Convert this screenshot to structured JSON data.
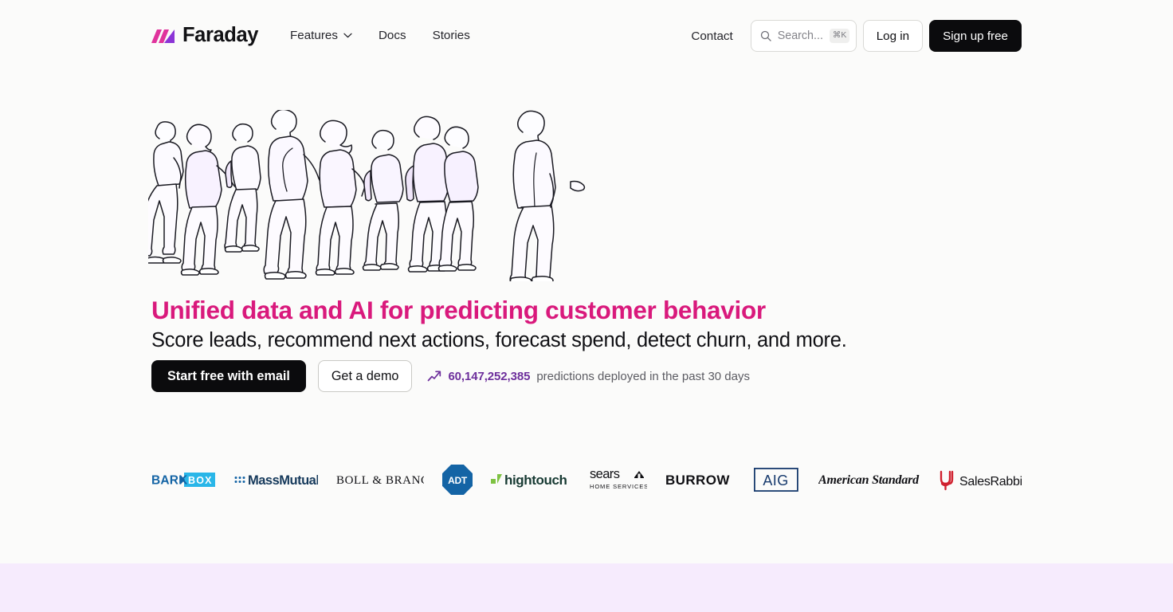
{
  "header": {
    "brand": {
      "name": "Faraday",
      "mark_colors": [
        "#e0339c",
        "#8b34d6"
      ]
    },
    "nav": [
      {
        "label": "Features",
        "has_dropdown": true,
        "icon": "chevron-down-icon"
      },
      {
        "label": "Docs",
        "has_dropdown": false
      },
      {
        "label": "Stories",
        "has_dropdown": false
      }
    ],
    "contact_label": "Contact",
    "search": {
      "placeholder": "Search...",
      "shortcut": "⌘K",
      "icon": "search-icon"
    },
    "login_label": "Log in",
    "signup_label": "Sign up free"
  },
  "hero": {
    "illustration_alt": "Line drawing of a crowd of people walking",
    "title": "Unified data and AI for predicting customer behavior",
    "subtitle": "Score leads, recommend next actions, forecast spend, detect churn, and more.",
    "primary_cta": "Start free with email",
    "secondary_cta": "Get a demo",
    "stat": {
      "icon": "trending-up-icon",
      "number": "60,147,252,385",
      "text": "predictions deployed in the past 30 days",
      "number_color": "#6d2f9c"
    },
    "title_color": "#d9197c"
  },
  "logos": [
    {
      "name": "BarkBox",
      "id": "barkbox"
    },
    {
      "name": "MassMutual",
      "id": "massmutual"
    },
    {
      "name": "BOLL & BRANCH",
      "id": "boll-and-branch"
    },
    {
      "name": "ADT",
      "id": "adt"
    },
    {
      "name": "hightouch",
      "id": "hightouch"
    },
    {
      "name": "sears HOME SERVICES",
      "id": "sears-home-services"
    },
    {
      "name": "BURROW",
      "id": "burrow"
    },
    {
      "name": "AIG",
      "id": "aig"
    },
    {
      "name": "American Standard",
      "id": "american-standard"
    },
    {
      "name": "SalesRabbit",
      "id": "salesrabbit"
    }
  ],
  "colors": {
    "page_background": "#fbfbfa",
    "bottom_band": "#f6ebfd",
    "brand_pink": "#d9197c",
    "brand_purple": "#6d2f9c",
    "ink": "#0b0b0d"
  }
}
